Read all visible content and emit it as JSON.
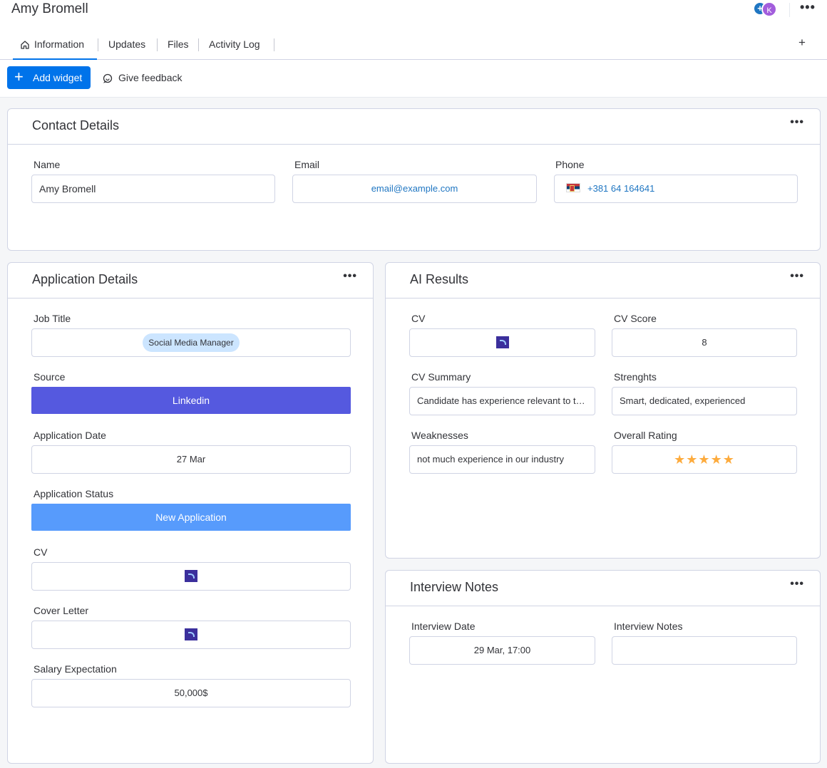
{
  "header": {
    "title": "Amy Bromell",
    "avatar_initial": "K",
    "avatar_plus": "+",
    "more": "•••"
  },
  "tabs": [
    {
      "label": "Information",
      "active": true
    },
    {
      "label": "Updates"
    },
    {
      "label": "Files"
    },
    {
      "label": "Activity Log"
    }
  ],
  "tabs_add": "+",
  "toolbar": {
    "add_widget_label": "Add widget",
    "feedback_label": "Give feedback"
  },
  "contact": {
    "title": "Contact Details",
    "name_label": "Name",
    "name_value": "Amy Bromell",
    "email_label": "Email",
    "email_value": "email@example.com",
    "phone_label": "Phone",
    "phone_value": "+381 64 164641"
  },
  "application": {
    "title": "Application Details",
    "job_title_label": "Job Title",
    "job_title_value": "Social Media Manager",
    "source_label": "Source",
    "source_value": "Linkedin",
    "source_color": "#5559df",
    "date_label": "Application Date",
    "date_value": "27 Mar",
    "status_label": "Application Status",
    "status_value": "New Application",
    "status_color": "#579bfc",
    "cv_label": "CV",
    "cover_label": "Cover Letter",
    "salary_label": "Salary Expectation",
    "salary_value": "50,000$"
  },
  "ai": {
    "title": "AI Results",
    "cv_label": "CV",
    "score_label": "CV Score",
    "score_value": "8",
    "summary_label": "CV Summary",
    "summary_value": "Candidate has experience relevant to the role and a strong background",
    "strengths_label": "Strenghts",
    "strengths_value": "Smart, dedicated, experienced",
    "weak_label": "Weaknesses",
    "weak_value": "not much experience in our industry",
    "rating_label": "Overall Rating",
    "rating_value": 5,
    "rating_stars": "★★★★★",
    "rating_color": "#fdab3d"
  },
  "interview": {
    "title": "Interview Notes",
    "date_label": "Interview Date",
    "date_value": "29 Mar, 17:00",
    "notes_label": "Interview Notes",
    "notes_value": ""
  },
  "widget_more": "•••",
  "colors": {
    "primary": "#0073ea",
    "link": "#1f76c2",
    "tag_bg": "#cce5ff"
  }
}
